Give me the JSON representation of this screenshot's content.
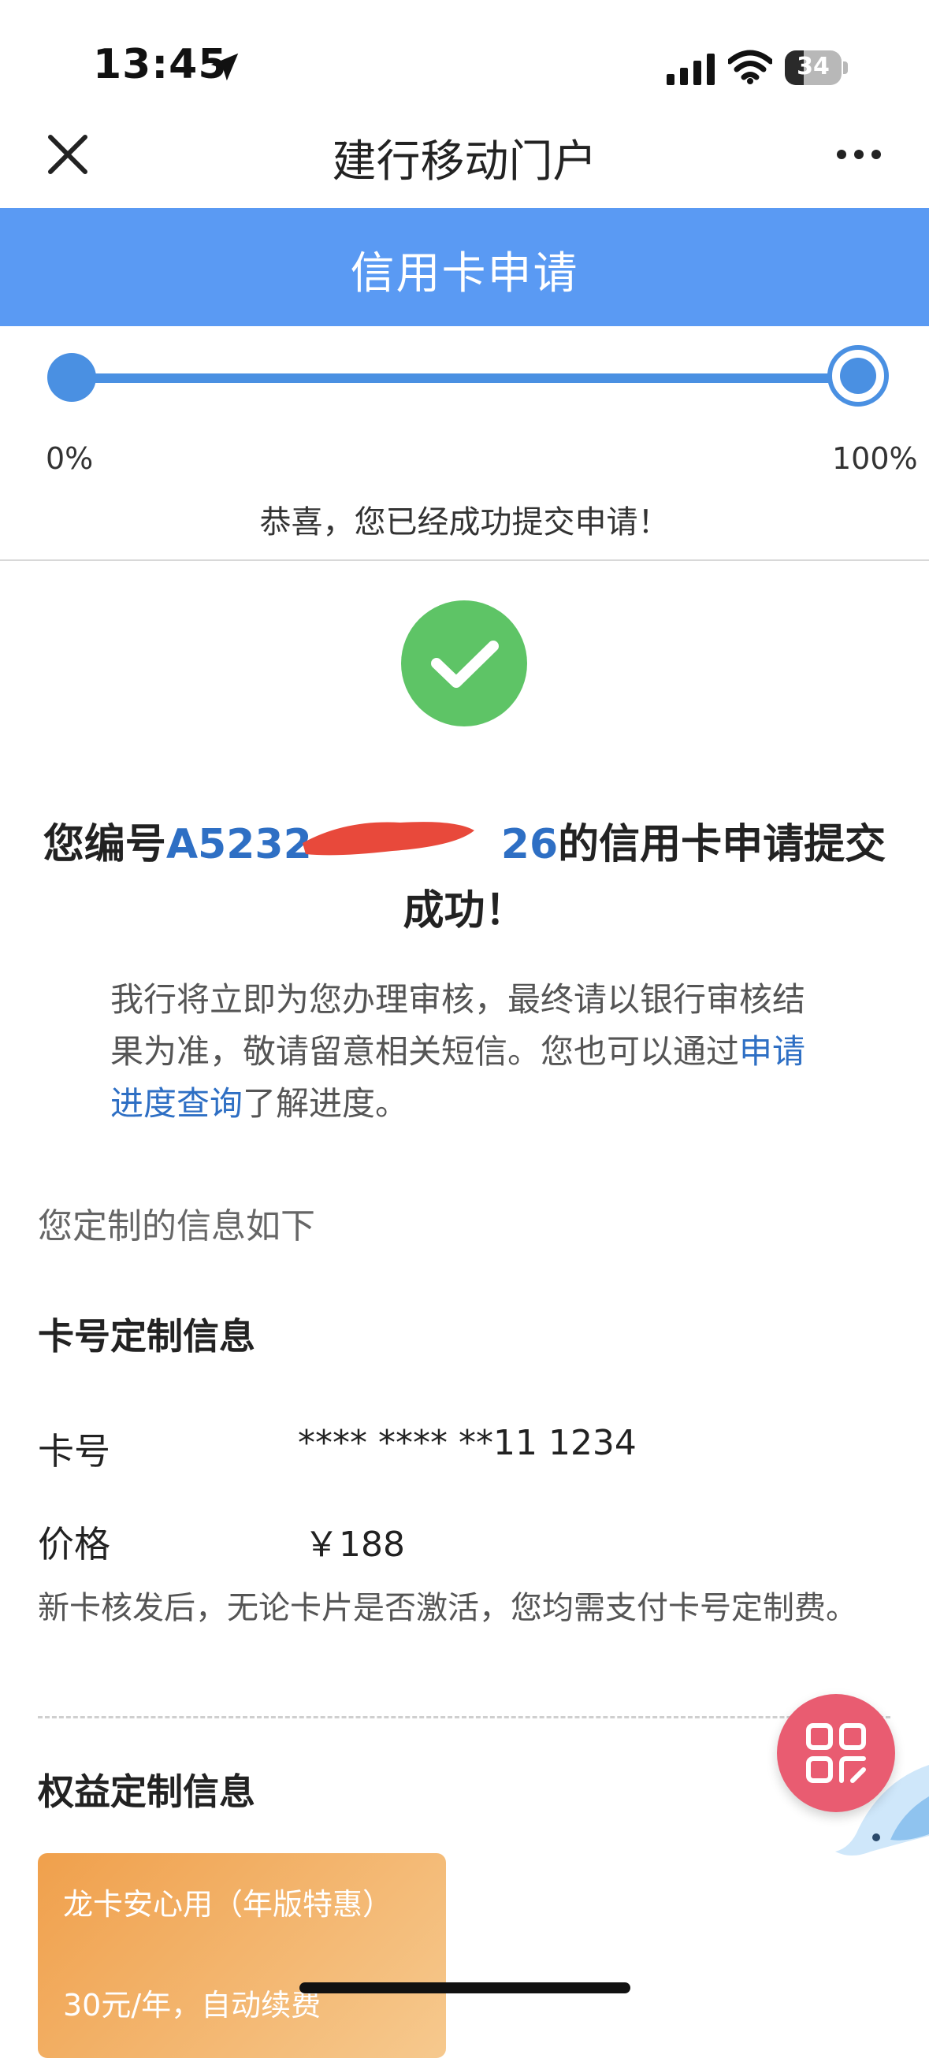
{
  "status_bar": {
    "time": "13:45",
    "battery": "34",
    "battery_level": 0.34
  },
  "nav": {
    "title": "建行移动门户"
  },
  "header": {
    "title": "信用卡申请"
  },
  "progress": {
    "start_label": "0%",
    "end_label": "100%",
    "value": 1.0,
    "message": "恭喜，您已经成功提交申请！"
  },
  "success": {
    "prefix": "您编号",
    "app_number": "A5232",
    "app_number_tail": "26",
    "suffix": "的信用卡申请提交成功！",
    "desc_text": "我行将立即为您办理审核，最终请以银行审核结果为准，敬请留意相关短信。您也可以通过",
    "desc_link": "申请进度查询",
    "desc_end": "了解进度。"
  },
  "custom_info": {
    "intro": "您定制的信息如下",
    "card_section_title": "卡号定制信息",
    "card_no_label": "卡号",
    "card_no_value": "**** **** **11 1234",
    "price_label": "价格",
    "price_value": "￥188",
    "note": "新卡核发后，无论卡片是否激活，您均需支付卡号定制费。",
    "benefit_section_title": "权益定制信息",
    "benefit_name": "龙卡安心用（年版特惠）",
    "benefit_price": "30元/年，自动续费"
  },
  "colors": {
    "header_blue": "#5a9af3",
    "progress_blue": "#4a90e2",
    "success_green": "#5ec466",
    "link_blue": "#2e6fc4",
    "fab_pink": "#e95c71",
    "benefit_orange": "#f0a04c"
  },
  "icons": {
    "location": "location-arrow-icon",
    "signal": "cellular-signal-icon",
    "wifi": "wifi-icon",
    "close": "close-icon",
    "more": "more-dots-icon",
    "check": "check-icon",
    "fab": "grid-apps-icon"
  }
}
